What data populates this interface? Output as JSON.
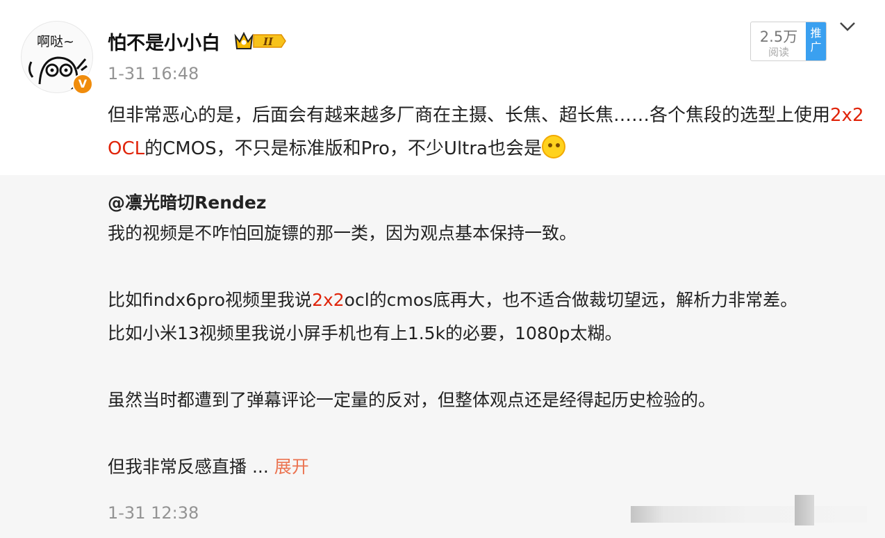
{
  "post": {
    "avatar_text": "啊哒~",
    "verified_badge": "V",
    "username": "怕不是小小白",
    "level_badge": "II",
    "time": "1-31 16:48",
    "read_count": "2.5万",
    "read_label": "阅读",
    "promote_label": "推广",
    "text": {
      "part1": "但非常恶心的是，后面会有越来越多厂商在主摄、长焦、超长焦……各个焦段的选型上使用",
      "highlight": "2x2 OCL",
      "part2": "的CMOS，不只是标准版和Pro，不少Ultra也会是"
    }
  },
  "repost": {
    "author": "@凛光暗切Rendez",
    "line1": "我的视频是不咋怕回旋镖的那一类，因为观点基本保持一致。",
    "line2a": "比如findx6pro视频里我说",
    "line2_highlight": "2x2",
    "line2b": "ocl的cmos底再大，也不适合做裁切望远，解析力非常差。",
    "line3": "比如小米13视频里我说小屏手机也有上1.5k的必要，1080p太糊。",
    "line4": "虽然当时都遭到了弹幕评论一定量的反对，但整体观点还是经得起历史检验的。",
    "line5": "但我非常反感直播  ... ",
    "expand_label": "展开",
    "time": "1-31 12:38"
  },
  "colors": {
    "highlight": "#e0240a",
    "link": "#eb7350",
    "meta": "#939393",
    "promo": "#3aa0f0",
    "verified": "#f08c0c"
  },
  "icons": [
    "cartoon-avatar-icon",
    "verified-badge-icon",
    "crown-level-icon",
    "chevron-down-icon",
    "thinking-face-emoji-icon"
  ]
}
